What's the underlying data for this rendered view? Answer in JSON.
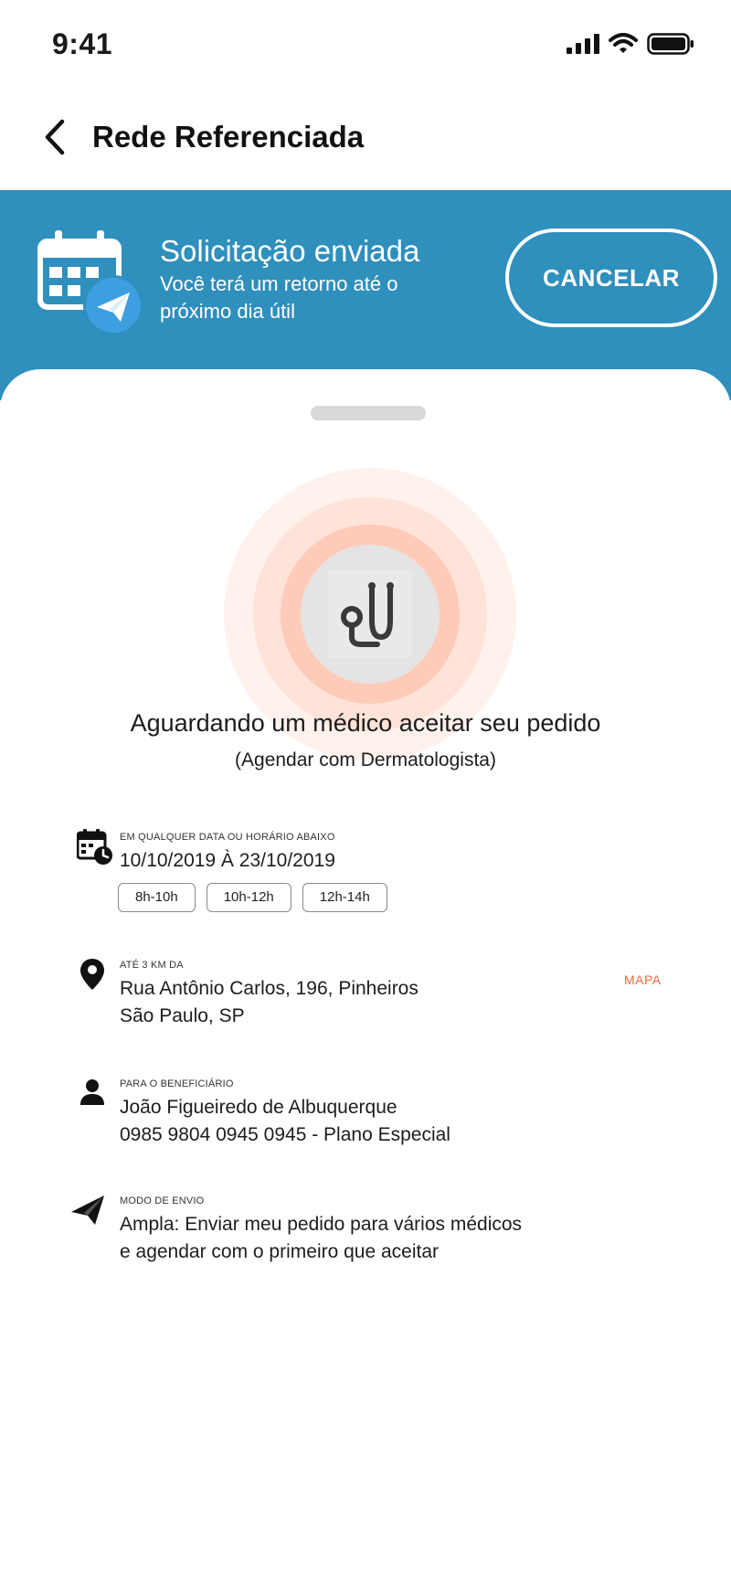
{
  "status_bar": {
    "time": "9:41"
  },
  "nav": {
    "title": "Rede Referenciada"
  },
  "banner": {
    "title": "Solicitação enviada",
    "subtitle": "Você terá um retorno até o próximo dia útil",
    "cancel_label": "CANCELAR",
    "color": "#2f8fbd"
  },
  "waiting": {
    "title": "Aguardando um médico aceitar seu pedido",
    "subtitle": "(Agendar com Dermatologista)",
    "icon": "stethoscope-icon",
    "pulse_color": "#ffcbb9"
  },
  "schedule": {
    "label": "EM QUALQUER DATA OU HORÁRIO ABAIXO",
    "dates": "10/10/2019 À 23/10/2019",
    "slots": [
      "8h-10h",
      "10h-12h",
      "12h-14h"
    ]
  },
  "location": {
    "label": "ATÉ 3 KM DA",
    "address_line1": "Rua Antônio Carlos, 196, Pinheiros",
    "address_line2": "São Paulo, SP",
    "map_label": "MAPA",
    "accent": "#f26a3d"
  },
  "beneficiary": {
    "label": "PARA O BENEFICIÁRIO",
    "name": "João Figueiredo de Albuquerque",
    "plan": "0985 9804 0945 0945 - Plano Especial"
  },
  "send_mode": {
    "label": "MODO DE ENVIO",
    "line1": "Ampla: Enviar meu pedido para vários médicos",
    "line2": "e agendar com o primeiro que aceitar"
  }
}
